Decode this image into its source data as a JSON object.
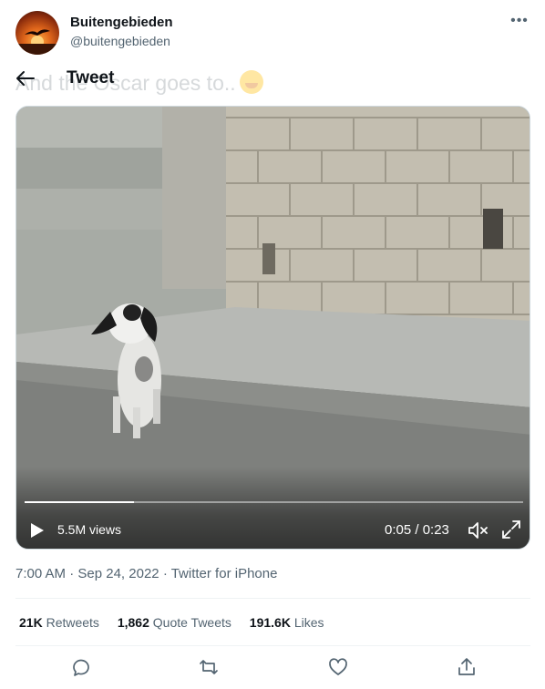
{
  "author": {
    "display_name": "Buitengebieden",
    "handle": "@buitengebieden",
    "avatar_icon": "sunset-bird-avatar"
  },
  "header": {
    "title": "Tweet",
    "underlying_text": "And the Oscar goes to.."
  },
  "video": {
    "views": "5.5M views",
    "time": "0:05 / 0:23",
    "progress": 0.22,
    "icons": [
      "play-icon",
      "mute-icon",
      "fullscreen-icon"
    ]
  },
  "meta": {
    "time": "7:00 AM",
    "separator": "·",
    "date": "Sep 24, 2022",
    "source": "Twitter for iPhone"
  },
  "stats": {
    "retweets_count": "21K",
    "retweets_label": "Retweets",
    "quotes_count": "1,862",
    "quotes_label": "Quote Tweets",
    "likes_count": "191.6K",
    "likes_label": "Likes"
  },
  "actions": [
    "reply-icon",
    "retweet-icon",
    "like-icon",
    "share-icon"
  ],
  "colors": {
    "text_primary": "#0f1419",
    "text_secondary": "#536471",
    "divider": "#eff3f4"
  }
}
